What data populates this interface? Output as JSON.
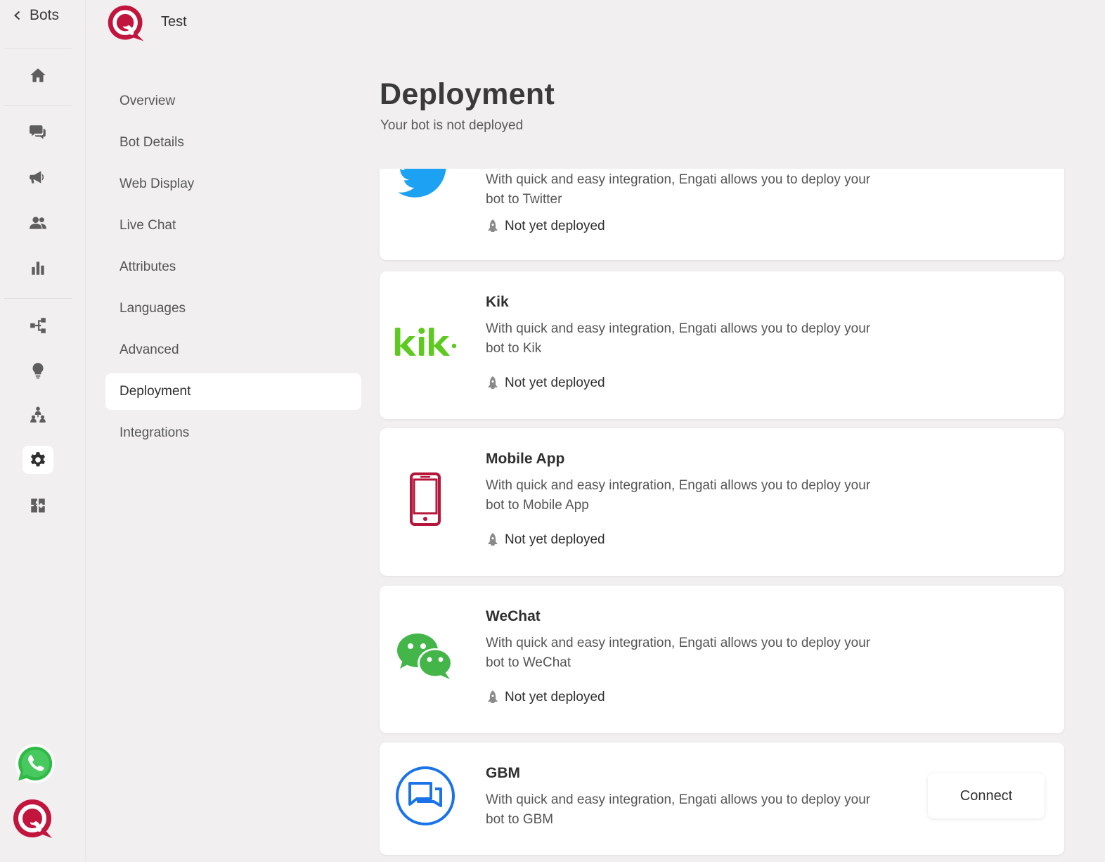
{
  "nav": {
    "back_label": "Bots"
  },
  "header": {
    "bot_name": "Test"
  },
  "settings_menu": {
    "items": [
      {
        "label": "Overview",
        "active": false
      },
      {
        "label": "Bot Details",
        "active": false
      },
      {
        "label": "Web Display",
        "active": false
      },
      {
        "label": "Live Chat",
        "active": false
      },
      {
        "label": "Attributes",
        "active": false
      },
      {
        "label": "Languages",
        "active": false
      },
      {
        "label": "Advanced",
        "active": false
      },
      {
        "label": "Deployment",
        "active": true
      },
      {
        "label": "Integrations",
        "active": false
      }
    ]
  },
  "page": {
    "title": "Deployment",
    "subtitle": "Your bot is not deployed"
  },
  "channels": [
    {
      "name": "Twitter",
      "description": "With quick and easy integration, Engati allows you to deploy your bot to Twitter",
      "status": "Not yet deployed",
      "icon": "twitter-bird",
      "color": "#1da1f2"
    },
    {
      "name": "Kik",
      "description": "With quick and easy integration, Engati allows you to deploy your bot to Kik",
      "status": "Not yet deployed",
      "icon": "kik-logo",
      "color": "#5dca1f"
    },
    {
      "name": "Mobile App",
      "description": "With quick and easy integration, Engati allows you to deploy your bot to Mobile App",
      "status": "Not yet deployed",
      "icon": "mobile-phone",
      "color": "#b5163a"
    },
    {
      "name": "WeChat",
      "description": "With quick and easy integration, Engati allows you to deploy your bot to WeChat",
      "status": "Not yet deployed",
      "icon": "wechat-bubbles",
      "color": "#44b549"
    },
    {
      "name": "GBM",
      "description": "With quick and easy integration, Engati allows you to deploy your bot to GBM",
      "action": "Connect",
      "icon": "gbm-chat",
      "color": "#1a73e8"
    }
  ],
  "rail_icons": [
    "home-icon",
    "chat-icon",
    "broadcast-icon",
    "users-icon",
    "analytics-icon",
    "flow-icon",
    "ideas-icon",
    "team-icon",
    "gear-icon",
    "integrations-icon",
    "whatsapp-icon",
    "engati-logo-icon"
  ],
  "colors": {
    "brand": "#c2153d",
    "background": "#f1eff0",
    "card": "#ffffff"
  }
}
